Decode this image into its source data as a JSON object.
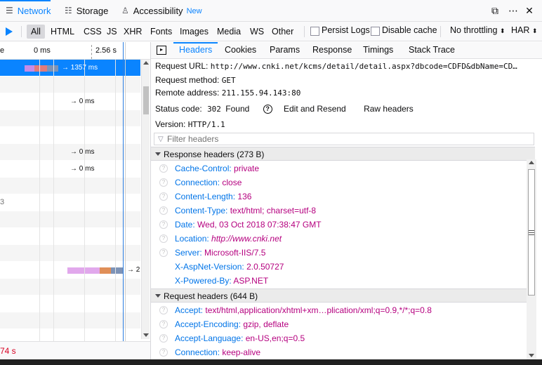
{
  "toolbar": {
    "tabs": [
      {
        "label": "Network",
        "icon": "network-icon"
      },
      {
        "label": "Storage",
        "icon": "storage-icon"
      },
      {
        "label": "Accessibility",
        "icon": "accessibility-icon",
        "badge": "New"
      }
    ]
  },
  "filters": {
    "types": [
      "All",
      "HTML",
      "CSS",
      "JS",
      "XHR",
      "Fonts",
      "Images",
      "Media",
      "WS",
      "Other"
    ],
    "persist_logs": "Persist Logs",
    "disable_cache": "Disable cache",
    "throttling": "No throttling",
    "har": "HAR"
  },
  "waterfall": {
    "header_left": "e",
    "tick_0": "0 ms",
    "tick_1": "2.56 s",
    "row_1_time": "→ 1357 ms",
    "row_3_time": "→ 0 ms",
    "row_6_time": "→ 0 ms",
    "row_7_time": "→ 0 ms",
    "row_9_frag": "3",
    "row_12_time": "→ 2",
    "footer_time": "74 s"
  },
  "details": {
    "tabs": [
      "Headers",
      "Cookies",
      "Params",
      "Response",
      "Timings",
      "Stack Trace"
    ],
    "request_url_label": "Request URL:",
    "request_url": "http://www.cnki.net/kcms/detail/detail.aspx?dbcode=CDFD&dbName=CD…",
    "method_label": "Request method:",
    "method": "GET",
    "remote_label": "Remote address:",
    "remote": "211.155.94.143:80",
    "status_label": "Status code:",
    "status_code": "302",
    "status_text": "Found",
    "edit_resend": "Edit and Resend",
    "raw_headers": "Raw headers",
    "version_label": "Version:",
    "version": "HTTP/1.1",
    "filter_placeholder": "Filter headers"
  },
  "response_headers": {
    "title": "Response headers (273 B)",
    "items": [
      {
        "name": "Cache-Control:",
        "value": "private"
      },
      {
        "name": "Connection:",
        "value": "close"
      },
      {
        "name": "Content-Length:",
        "value": "136"
      },
      {
        "name": "Content-Type:",
        "value": "text/html; charset=utf-8"
      },
      {
        "name": "Date:",
        "value": "Wed, 03 Oct 2018 07:38:47 GMT"
      },
      {
        "name": "Location:",
        "value": "http://www.cnki.net"
      },
      {
        "name": "Server:",
        "value": "Microsoft-IIS/7.5"
      },
      {
        "name": "X-AspNet-Version:",
        "value": "2.0.50727"
      },
      {
        "name": "X-Powered-By:",
        "value": "ASP.NET"
      }
    ]
  },
  "request_headers": {
    "title": "Request headers (644 B)",
    "items": [
      {
        "name": "Accept:",
        "value": "text/html,application/xhtml+xm…plication/xml;q=0.9,*/*;q=0.8"
      },
      {
        "name": "Accept-Encoding:",
        "value": "gzip, deflate"
      },
      {
        "name": "Accept-Language:",
        "value": "en-US,en;q=0.5"
      },
      {
        "name": "Connection:",
        "value": "keep-alive"
      }
    ]
  },
  "colors": {
    "accent": "#0a84ff",
    "header_name": "#0074e8",
    "header_value": "#b5007f"
  }
}
